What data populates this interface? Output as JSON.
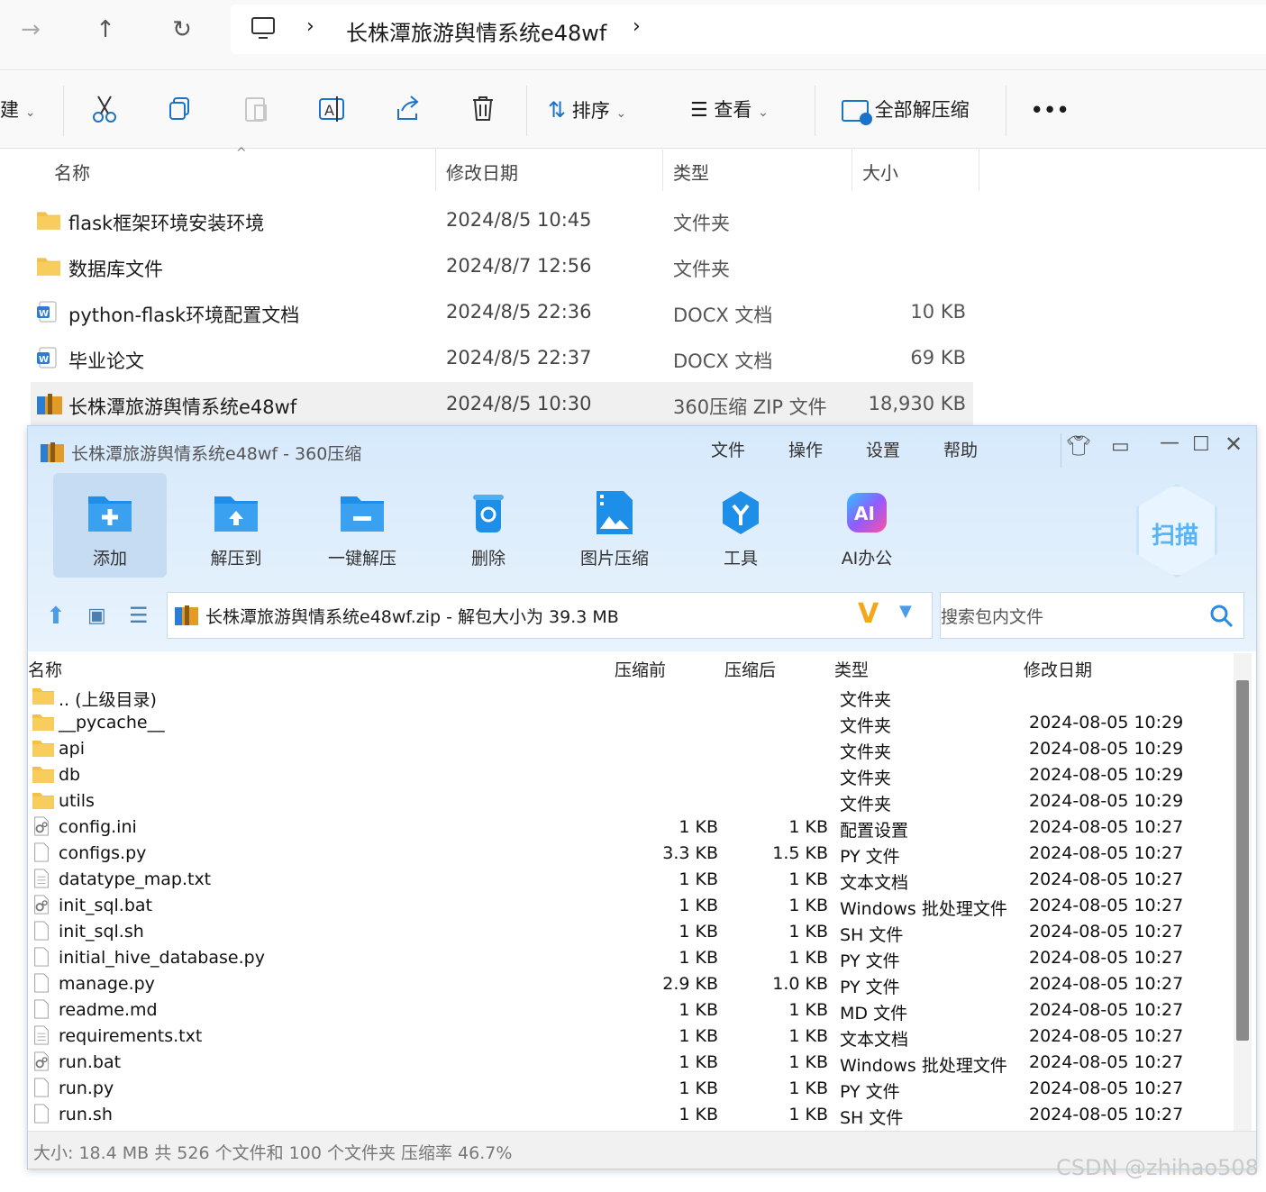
{
  "explorer": {
    "breadcrumb": "长株潭旅游舆情系统e48wf",
    "toolbar": {
      "new_label": "建",
      "sort_label": "排序",
      "view_label": "查看",
      "extract_all_label": "全部解压缩",
      "more_label": "•••"
    },
    "columns": {
      "name": "名称",
      "modified": "修改日期",
      "type": "类型",
      "size": "大小"
    },
    "rows": [
      {
        "name": "flask框架环境安装环境",
        "modified": "2024/8/5 10:45",
        "type": "文件夹",
        "size": "",
        "icon": "folder-icon"
      },
      {
        "name": "数据库文件",
        "modified": "2024/8/7 12:56",
        "type": "文件夹",
        "size": "",
        "icon": "folder-icon"
      },
      {
        "name": "python-flask环境配置文档",
        "modified": "2024/8/5 22:36",
        "type": "DOCX 文档",
        "size": "10 KB",
        "icon": "word-doc-icon"
      },
      {
        "name": "毕业论文",
        "modified": "2024/8/5 22:37",
        "type": "DOCX 文档",
        "size": "69 KB",
        "icon": "word-doc-icon"
      },
      {
        "name": "长株潭旅游舆情系统e48wf",
        "modified": "2024/8/5 10:30",
        "type": "360压缩 ZIP 文件",
        "size": "18,930 KB",
        "icon": "zip-archive-icon"
      }
    ]
  },
  "zip": {
    "title": "长株潭旅游舆情系统e48wf - 360压缩",
    "menu": [
      "文件",
      "操作",
      "设置",
      "帮助"
    ],
    "tools": [
      {
        "label": "添加",
        "icon": "add-folder-icon"
      },
      {
        "label": "解压到",
        "icon": "extract-to-icon"
      },
      {
        "label": "一键解压",
        "icon": "one-click-extract-icon"
      },
      {
        "label": "删除",
        "icon": "delete-bin-icon"
      },
      {
        "label": "图片压缩",
        "icon": "image-compress-icon"
      },
      {
        "label": "工具",
        "icon": "tools-icon"
      },
      {
        "label": "AI办公",
        "icon": "ai-office-icon"
      }
    ],
    "scan_label": "扫描",
    "path": "长株潭旅游舆情系统e48wf.zip - 解包大小为 39.3 MB",
    "search_placeholder": "搜索包内文件",
    "columns": {
      "name": "名称",
      "before": "压缩前",
      "after": "压缩后",
      "type": "类型",
      "modified": "修改日期"
    },
    "rows": [
      {
        "name": ".. (上级目录)",
        "before": "",
        "after": "",
        "type": "文件夹",
        "modified": "",
        "icon": "folder-icon"
      },
      {
        "name": "__pycache__",
        "before": "",
        "after": "",
        "type": "文件夹",
        "modified": "2024-08-05 10:29",
        "icon": "folder-icon"
      },
      {
        "name": "api",
        "before": "",
        "after": "",
        "type": "文件夹",
        "modified": "2024-08-05 10:29",
        "icon": "folder-icon"
      },
      {
        "name": "db",
        "before": "",
        "after": "",
        "type": "文件夹",
        "modified": "2024-08-05 10:29",
        "icon": "folder-icon"
      },
      {
        "name": "utils",
        "before": "",
        "after": "",
        "type": "文件夹",
        "modified": "2024-08-05 10:29",
        "icon": "folder-icon"
      },
      {
        "name": "config.ini",
        "before": "1 KB",
        "after": "1 KB",
        "type": "配置设置",
        "modified": "2024-08-05 10:27",
        "icon": "settings-file-icon"
      },
      {
        "name": "configs.py",
        "before": "3.3 KB",
        "after": "1.5 KB",
        "type": "PY 文件",
        "modified": "2024-08-05 10:27",
        "icon": "file-icon"
      },
      {
        "name": "datatype_map.txt",
        "before": "1 KB",
        "after": "1 KB",
        "type": "文本文档",
        "modified": "2024-08-05 10:27",
        "icon": "text-file-icon"
      },
      {
        "name": "init_sql.bat",
        "before": "1 KB",
        "after": "1 KB",
        "type": "Windows 批处理文件",
        "modified": "2024-08-05 10:27",
        "icon": "batch-file-icon"
      },
      {
        "name": "init_sql.sh",
        "before": "1 KB",
        "after": "1 KB",
        "type": "SH 文件",
        "modified": "2024-08-05 10:27",
        "icon": "file-icon"
      },
      {
        "name": "initial_hive_database.py",
        "before": "1 KB",
        "after": "1 KB",
        "type": "PY 文件",
        "modified": "2024-08-05 10:27",
        "icon": "file-icon"
      },
      {
        "name": "manage.py",
        "before": "2.9 KB",
        "after": "1.0 KB",
        "type": "PY 文件",
        "modified": "2024-08-05 10:27",
        "icon": "file-icon"
      },
      {
        "name": "readme.md",
        "before": "1 KB",
        "after": "1 KB",
        "type": "MD 文件",
        "modified": "2024-08-05 10:27",
        "icon": "file-icon"
      },
      {
        "name": "requirements.txt",
        "before": "1 KB",
        "after": "1 KB",
        "type": "文本文档",
        "modified": "2024-08-05 10:27",
        "icon": "text-file-icon"
      },
      {
        "name": "run.bat",
        "before": "1 KB",
        "after": "1 KB",
        "type": "Windows 批处理文件",
        "modified": "2024-08-05 10:27",
        "icon": "batch-file-icon"
      },
      {
        "name": "run.py",
        "before": "1 KB",
        "after": "1 KB",
        "type": "PY 文件",
        "modified": "2024-08-05 10:27",
        "icon": "file-icon"
      },
      {
        "name": "run.sh",
        "before": "1 KB",
        "after": "1 KB",
        "type": "SH 文件",
        "modified": "2024-08-05 10:27",
        "icon": "file-icon"
      }
    ],
    "status": "大小: 18.4 MB 共 526 个文件和 100 个文件夹 压缩率 46.7%"
  },
  "watermark": "CSDN @zhihao508",
  "colors": {
    "folder": "#f4c04a",
    "word": "#2b7cd3",
    "accent": "#1e8fe8",
    "zip_bg": "#d6e9fb"
  }
}
